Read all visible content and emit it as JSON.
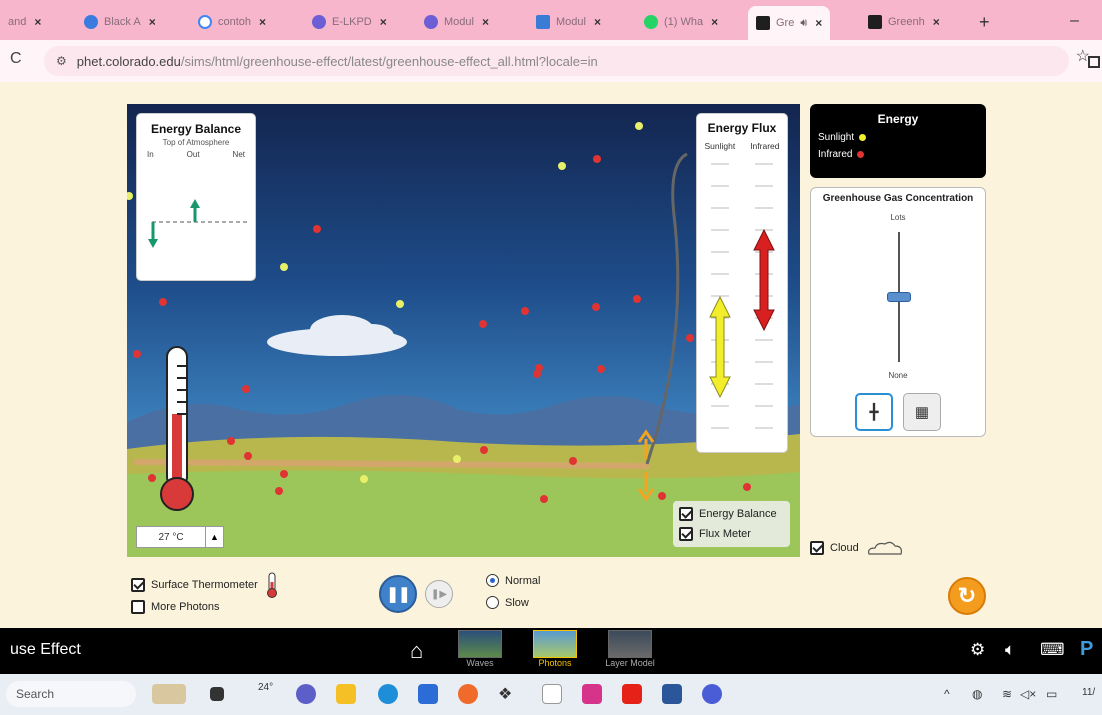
{
  "browser": {
    "tabs": [
      {
        "label": "and",
        "color": "#f0b7c7"
      },
      {
        "label": "Black A",
        "color": "#3b7be0"
      },
      {
        "label": "contoh",
        "color": "#4285f4"
      },
      {
        "label": "E-LKPD",
        "color": "#6d5ed6"
      },
      {
        "label": "Modul",
        "color": "#6d5ed6"
      },
      {
        "label": "Modul",
        "color": "#3a7bd5"
      },
      {
        "label": "(1) Wha",
        "color": "#25d366"
      },
      {
        "label": "Gre",
        "color": "#1f1f1f"
      },
      {
        "label": "Greenh",
        "color": "#1f1f1f"
      }
    ],
    "close_glyph": "×",
    "add_tab": "+",
    "minimize": "–",
    "url_host": "phet.colorado.edu",
    "url_path": "/sims/html/greenhouse-effect/latest/greenhouse-effect_all.html?locale=in",
    "star_icon": "☆"
  },
  "sim": {
    "energy_balance": {
      "title": "Energy Balance",
      "subtitle": "Top of Atmosphere",
      "col_in": "In",
      "col_out": "Out",
      "col_net": "Net"
    },
    "energy_flux": {
      "title": "Energy Flux",
      "col_sunlight": "Sunlight",
      "col_infrared": "Infrared"
    },
    "scene_checkboxes": {
      "energy_balance": "Energy Balance",
      "flux_meter": "Flux Meter"
    },
    "temperature": {
      "value": "27 °C",
      "up": "▲"
    },
    "legend": {
      "title": "Energy",
      "sunlight": "Sunlight",
      "infrared": "Infrared",
      "sunlight_color": "#f4ef2e",
      "infrared_color": "#e03434"
    },
    "ghg": {
      "title": "Greenhouse Gas Concentration",
      "top_label": "Lots",
      "bottom_label": "None",
      "slider_level": 0.5
    },
    "cloud_label": "Cloud",
    "controls": {
      "surface_thermometer": "Surface Thermometer",
      "more_photons": "More Photons",
      "speed_normal": "Normal",
      "speed_slow": "Slow"
    }
  },
  "nav": {
    "title": "use Effect",
    "screens": [
      "Waves",
      "Photons",
      "Layer Model"
    ],
    "selected_screen": "Photons"
  },
  "taskbar": {
    "search_placeholder": "Search",
    "weather": "24°",
    "clock": "11/"
  }
}
